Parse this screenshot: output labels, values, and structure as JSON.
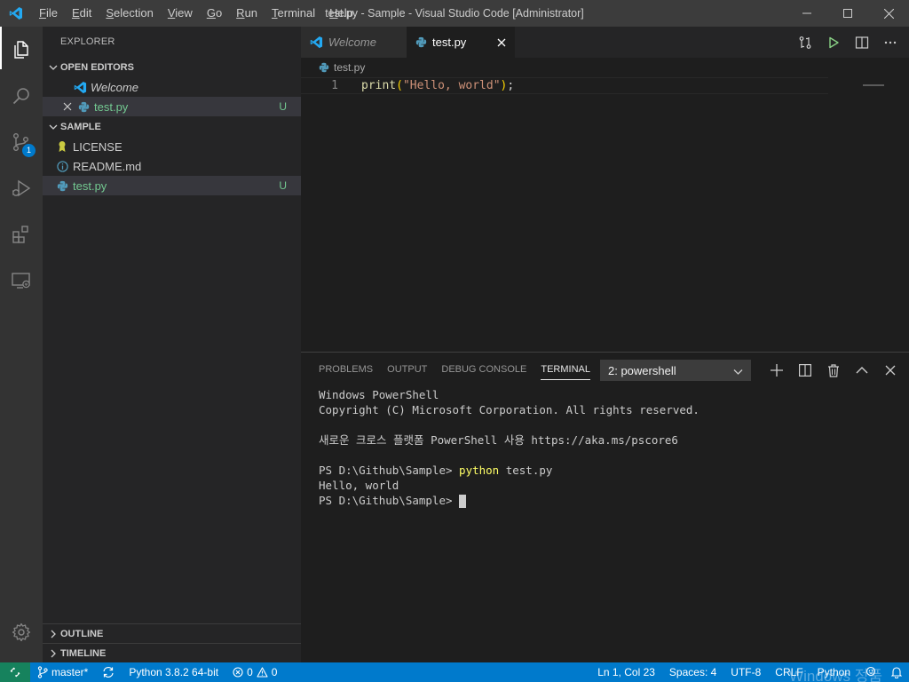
{
  "titlebar": {
    "menu": [
      "File",
      "Edit",
      "Selection",
      "View",
      "Go",
      "Run",
      "Terminal",
      "Help"
    ],
    "menu_mnemonic_index": [
      0,
      0,
      0,
      0,
      0,
      0,
      0,
      0
    ],
    "window_title": "test.py - Sample - Visual Studio Code [Administrator]"
  },
  "activitybar": {
    "items": [
      "explorer-icon",
      "search-icon",
      "source-control-icon",
      "run-debug-icon",
      "extensions-icon",
      "remote-explorer-icon"
    ],
    "source_control_badge": "1",
    "bottom": "settings-gear-icon"
  },
  "sidebar": {
    "title": "EXPLORER",
    "open_editors": {
      "header": "OPEN EDITORS",
      "items": [
        {
          "label": "Welcome",
          "icon": "vscode-icon"
        },
        {
          "label": "test.py",
          "icon": "python-icon",
          "badge": "U"
        }
      ]
    },
    "folder": {
      "header": "SAMPLE",
      "items": [
        {
          "label": "LICENSE",
          "icon": "license-icon"
        },
        {
          "label": "README.md",
          "icon": "info-icon"
        },
        {
          "label": "test.py",
          "icon": "python-icon",
          "badge": "U"
        }
      ]
    },
    "outline": "OUTLINE",
    "timeline": "TIMELINE"
  },
  "editor": {
    "tabs": [
      {
        "label": "Welcome",
        "active": false
      },
      {
        "label": "test.py",
        "active": true
      }
    ],
    "breadcrumb": "test.py",
    "line_number": "1",
    "code": {
      "fn": "print",
      "open": "(",
      "str": "\"Hello, world\"",
      "close": ")",
      "semi": ";"
    }
  },
  "panel": {
    "tabs": [
      "PROBLEMS",
      "OUTPUT",
      "DEBUG CONSOLE",
      "TERMINAL"
    ],
    "active_tab": "TERMINAL",
    "terminal_select": "2: powershell",
    "terminal": {
      "line1": "Windows PowerShell",
      "line2": "Copyright (C) Microsoft Corporation. All rights reserved.",
      "line3": "새로운 크로스 플랫폼 PowerShell 사용 https://aka.ms/pscore6",
      "prompt1": "PS D:\\Github\\Sample> ",
      "cmd": "python",
      "cmd_arg": " test.py",
      "output": "Hello, world",
      "prompt2": "PS D:\\Github\\Sample> "
    }
  },
  "statusbar": {
    "branch": "master*",
    "interpreter": "Python 3.8.2 64-bit",
    "errors": "0",
    "warnings": "0",
    "position": "Ln 1, Col 23",
    "spaces": "Spaces: 4",
    "encoding": "UTF-8",
    "eol": "CRLF",
    "language": "Python",
    "watermark": "Windows 정품"
  },
  "colors": {
    "accent": "#007acc",
    "remote": "#16825d",
    "untracked": "#73c991",
    "vscode_blue": "#23a9f2"
  }
}
